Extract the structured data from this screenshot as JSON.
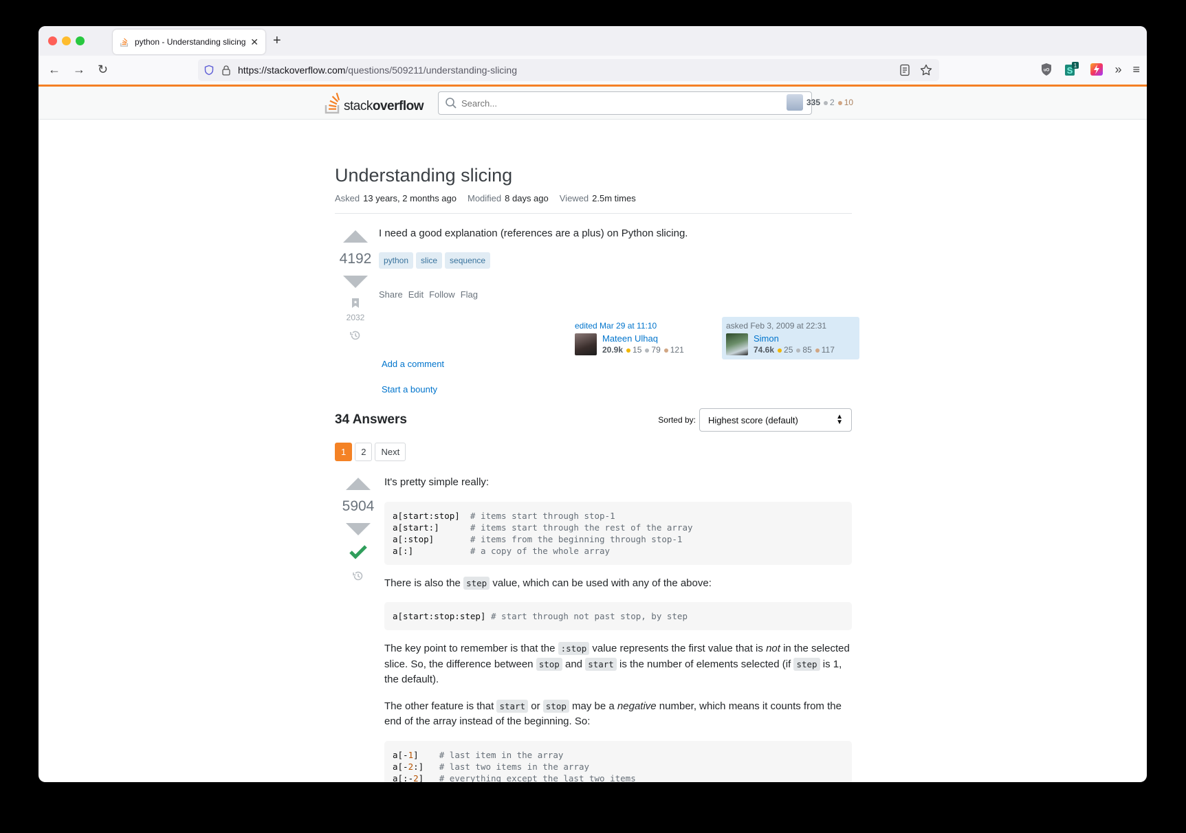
{
  "browser": {
    "tab_title": "python - Understanding slicing",
    "url_host": "https://stackoverflow.com",
    "url_path": "/questions/509211/understanding-slicing",
    "extension_badge": "1"
  },
  "site": {
    "logo_light": "stack",
    "logo_bold": "overflow",
    "search_placeholder": "Search...",
    "user": {
      "reputation": "335",
      "silver": "2",
      "bronze": "10"
    },
    "accent_color": "#f48024"
  },
  "question": {
    "title": "Understanding slicing",
    "meta": [
      {
        "label": "Asked",
        "value": "13 years, 2 months ago"
      },
      {
        "label": "Modified",
        "value": "8 days ago"
      },
      {
        "label": "Viewed",
        "value": "2.5m times"
      }
    ],
    "score": "4192",
    "bookmarks": "2032",
    "body": "I need a good explanation (references are a plus) on Python slicing.",
    "tags": [
      "python",
      "slice",
      "sequence"
    ],
    "menu": [
      "Share",
      "Edit",
      "Follow",
      "Flag"
    ],
    "editor": {
      "action": "edited Mar 29 at 11:10",
      "name": "Mateen Ulhaq",
      "rep": "20.9k",
      "gold": "15",
      "silver": "79",
      "bronze": "121"
    },
    "owner": {
      "action": "asked Feb 3, 2009 at 22:31",
      "name": "Simon",
      "rep": "74.6k",
      "gold": "25",
      "silver": "85",
      "bronze": "117"
    },
    "add_comment": "Add a comment",
    "start_bounty": "Start a bounty"
  },
  "answers": {
    "count_label": "34 Answers",
    "sort_label": "Sorted by:",
    "sort_value": "Highest score (default)",
    "pages": [
      "1",
      "2",
      "Next"
    ],
    "current_page": "1",
    "top": {
      "score": "5904",
      "accepted": true,
      "intro": "It's pretty simple really:",
      "code1": [
        {
          "code": "a[start:stop]  ",
          "comment": "# items start through stop-1"
        },
        {
          "code": "a[start:]      ",
          "comment": "# items start through the rest of the array"
        },
        {
          "code": "a[:stop]       ",
          "comment": "# items from the beginning through stop-1"
        },
        {
          "code": "a[:]           ",
          "comment": "# a copy of the whole array"
        }
      ],
      "p2_a": "There is also the ",
      "p2_code": "step",
      "p2_b": " value, which can be used with any of the above:",
      "code2": {
        "code": "a[start:stop:step] ",
        "comment": "# start through not past stop, by step"
      },
      "p3_a": "The key point to remember is that the ",
      "p3_code1": ":stop",
      "p3_b": " value represents the first value that is ",
      "p3_em": "not",
      "p3_c": " in the selected slice. So, the difference between ",
      "p3_code2": "stop",
      "p3_d": " and ",
      "p3_code3": "start",
      "p3_e": " is the number of elements selected (if ",
      "p3_code4": "step",
      "p3_f": " is 1, the default).",
      "p4_a": "The other feature is that ",
      "p4_code1": "start",
      "p4_b": " or ",
      "p4_code2": "stop",
      "p4_c": " may be a ",
      "p4_em": "negative",
      "p4_d": " number, which means it counts from the end of the array instead of the beginning. So:",
      "code3": [
        {
          "pre": "a[-",
          "num": "1",
          "post": "]    ",
          "comment": "# last item in the array"
        },
        {
          "pre": "a[-",
          "num": "2",
          "post": ":]   ",
          "comment": "# last two items in the array"
        },
        {
          "pre": "a[:-",
          "num": "2",
          "post": "]   ",
          "comment": "# everything except the last two items"
        }
      ]
    }
  }
}
